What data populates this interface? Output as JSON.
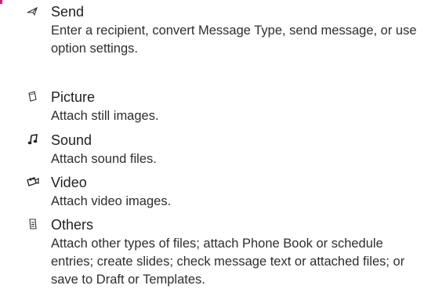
{
  "items": [
    {
      "icon": "send-icon",
      "title": "Send",
      "desc": "Enter a recipient, convert Message Type, send message, or use option settings."
    },
    {
      "icon": "picture-icon",
      "title": "Picture",
      "desc": "Attach still images."
    },
    {
      "icon": "sound-icon",
      "title": "Sound",
      "desc": "Attach sound files."
    },
    {
      "icon": "video-icon",
      "title": "Video",
      "desc": "Attach video images."
    },
    {
      "icon": "others-icon",
      "title": "Others",
      "desc": "Attach other types of files; attach Phone Book or schedule entries; create slides; check message text or attached files; or save to Draft or Templates."
    }
  ],
  "colors": {
    "text": "#2a2a2a",
    "accent_mark": "#e0147a"
  }
}
